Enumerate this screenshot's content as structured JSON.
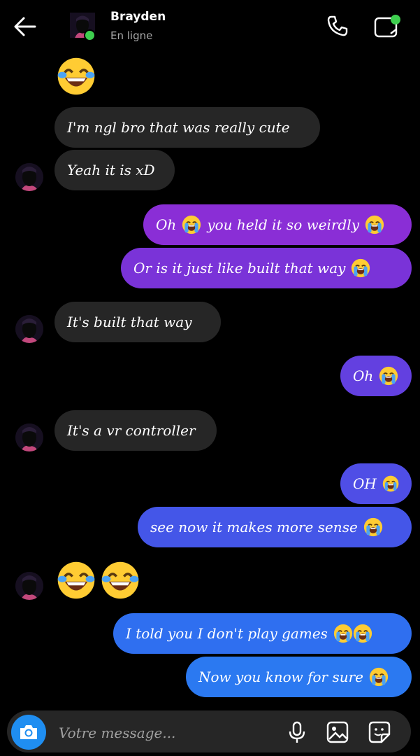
{
  "header": {
    "contact_name": "Brayden",
    "status": "En ligne"
  },
  "messages": [
    {
      "side": "received",
      "text": "",
      "emoji_count": 1,
      "emoji": "laughing-crying"
    },
    {
      "side": "received",
      "text": "I'm ngl bro that was really cute"
    },
    {
      "side": "received",
      "text": "Yeah it is xD"
    },
    {
      "side": "sent",
      "text": "Oh  you held it so weirdly ",
      "color": "#8a2ed6"
    },
    {
      "side": "sent",
      "text": "Or is it just like built that way ",
      "color": "#7a33d8"
    },
    {
      "side": "received",
      "text": "It's built that way"
    },
    {
      "side": "sent",
      "text": "Oh ",
      "color": "#6340e0"
    },
    {
      "side": "received",
      "text": "It's a vr controller"
    },
    {
      "side": "sent",
      "text": "OH ",
      "color": "#4f4ee6"
    },
    {
      "side": "sent",
      "text": "see now it makes more sense ",
      "color": "#4456e8"
    },
    {
      "side": "received",
      "text": "",
      "emoji_count": 2,
      "emoji": "laughing-crying"
    },
    {
      "side": "sent",
      "text": "I told you I don't play games ",
      "color": "#2f6ff0"
    },
    {
      "side": "sent",
      "text": "Now you know for sure ",
      "color": "#2b79f1"
    }
  ],
  "texts": {
    "m1": "I'm ngl bro that was really cute",
    "m2": "Yeah it is xD",
    "m3a": "Oh",
    "m3b": "you held it so weirdly",
    "m4": "Or is it just like built that way",
    "m5": "It's built that way",
    "m6": "Oh",
    "m7": "It's a vr controller",
    "m8": "OH",
    "m9": "see now it makes more sense",
    "m10": "I told you I don't play games",
    "m11": "Now you know for sure"
  },
  "composer": {
    "placeholder": "Votre message..."
  },
  "icons": [
    "back-arrow-icon",
    "phone-icon",
    "video-call-icon",
    "camera-icon",
    "microphone-icon",
    "gallery-icon",
    "sticker-icon",
    "laughing-crying-emoji",
    "loudly-crying-emoji"
  ],
  "colors": {
    "background": "#000000",
    "received_bubble": "#262626",
    "online": "#3ecf4f",
    "camera_button": "#1f8ef1"
  }
}
